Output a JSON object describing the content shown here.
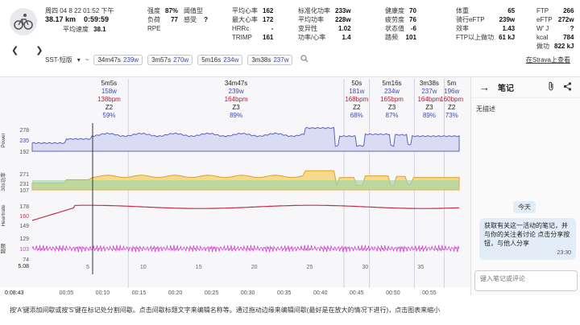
{
  "header": {
    "date": "周四 04 8 22   01:52 下午",
    "distance": "38.17 km",
    "time": "0:59:59",
    "avg_speed_label": "平均速度",
    "avg_speed": "38.1"
  },
  "metrics": [
    [
      {
        "k": "强度",
        "v": "87%"
      },
      {
        "k": "负荷",
        "v": "77"
      },
      {
        "k": "RPE",
        "v": ""
      }
    ],
    [
      {
        "k": "",
        "v": ""
      },
      {
        "k": "阈值型",
        "v": ""
      },
      {
        "k": "感受",
        "v": "?"
      }
    ],
    [
      {
        "k": "平均心率",
        "v": "162"
      },
      {
        "k": "最大心率",
        "v": "172"
      },
      {
        "k": "HRRc",
        "v": "-"
      },
      {
        "k": "TRIMP",
        "v": "161"
      }
    ],
    [
      {
        "k": "标准化功率",
        "v": "233w"
      },
      {
        "k": "平均功率",
        "v": "228w"
      },
      {
        "k": "变异性",
        "v": "1.02"
      },
      {
        "k": "功率/心率",
        "v": "1.4"
      }
    ],
    [
      {
        "k": "健康度",
        "v": "70"
      },
      {
        "k": "疲劳度",
        "v": "76"
      },
      {
        "k": "状态值",
        "v": "-6"
      },
      {
        "k": "踏频",
        "v": "101"
      }
    ],
    [
      {
        "k": "体重",
        "v": "65"
      },
      {
        "k": "骑行eFTP",
        "v": "239w"
      },
      {
        "k": "效率",
        "v": "1.43"
      },
      {
        "k": "FTP以上做功",
        "v": "61 kJ"
      }
    ],
    [
      {
        "k": "FTP",
        "v": "266"
      },
      {
        "k": "eFTP",
        "v": "272w"
      },
      {
        "k": "W' J",
        "v": "?"
      },
      {
        "k": "kcal",
        "v": "784"
      },
      {
        "k": "做功",
        "v": "822 kJ"
      }
    ]
  ],
  "lap_bar": {
    "label": "SST-短版",
    "chips": [
      {
        "t": "34m47s",
        "p": "239w"
      },
      {
        "t": "3m57s",
        "p": "270w"
      },
      {
        "t": "5m16s",
        "p": "234w"
      },
      {
        "t": "3m38s",
        "p": "237w"
      }
    ],
    "strava": "在Strava上查看"
  },
  "intervals": [
    {
      "dur": "5m5s",
      "pw": "158w",
      "hr": "138bpm",
      "zone": "Z2",
      "pct": "59%",
      "x0": 0.135,
      "x1": 0.225
    },
    {
      "dur": "34m47s",
      "pw": "239w",
      "hr": "164bpm",
      "zone": "Z3",
      "pct": "89%",
      "x0": 0.225,
      "x1": 0.73
    },
    {
      "dur": "50s",
      "pw": "181w",
      "hr": "168bpm",
      "zone": "Z2",
      "pct": "68%",
      "x0": 0.73,
      "x1": 0.79
    },
    {
      "dur": "5m16s",
      "pw": "234w",
      "hr": "165bpm",
      "zone": "Z3",
      "pct": "87%",
      "x0": 0.79,
      "x1": 0.895
    },
    {
      "dur": "3m38s",
      "pw": "237w",
      "hr": "164bpm",
      "zone": "Z3",
      "pct": "89%",
      "x0": 0.895,
      "x1": 0.965
    },
    {
      "dur": "5m",
      "pw": "196w",
      "hr": "160bpm",
      "zone": "Z2",
      "pct": "73%",
      "x0": 0.965,
      "x1": 1.05
    }
  ],
  "axes": {
    "power": {
      "label": "Power",
      "ticks": [
        "278",
        "235",
        "192"
      ]
    },
    "pw30": {
      "label": "30s功率",
      "ticks": [
        "271",
        "231",
        "107"
      ]
    },
    "hr": {
      "label": "Heartrate",
      "ticks": [
        "178",
        "160",
        "149"
      ]
    },
    "cad": {
      "label": "踏频",
      "ticks": [
        "129",
        "103",
        "74"
      ]
    },
    "bottom_left": "5.08",
    "time_left": "0:08:43"
  },
  "km_ticks": [
    "5",
    "10",
    "15",
    "20",
    "25",
    "30",
    "35"
  ],
  "time_ticks": [
    "00:05",
    "00:10",
    "00:15",
    "00:20",
    "00:25",
    "00:30",
    "00:35",
    "00:40",
    "00:45",
    "00:50",
    "00:55"
  ],
  "notes": {
    "title": "笔记",
    "no_desc": "无描述",
    "today": "今天",
    "message": "获取有关这一活动的笔记，并与你的关注者讨论 点击分享按钮，与他人分享",
    "msg_time": "23:30",
    "input_placeholder": "键入笔记或评论"
  },
  "footer": "按'A'键添加间歇或按'S'键在标记处分割间歇。点击间歇标题文字来编辑名称等。通过拖动边缘来编辑间歇(最好是在放大的情况下进行)，点击图表来缩小"
}
